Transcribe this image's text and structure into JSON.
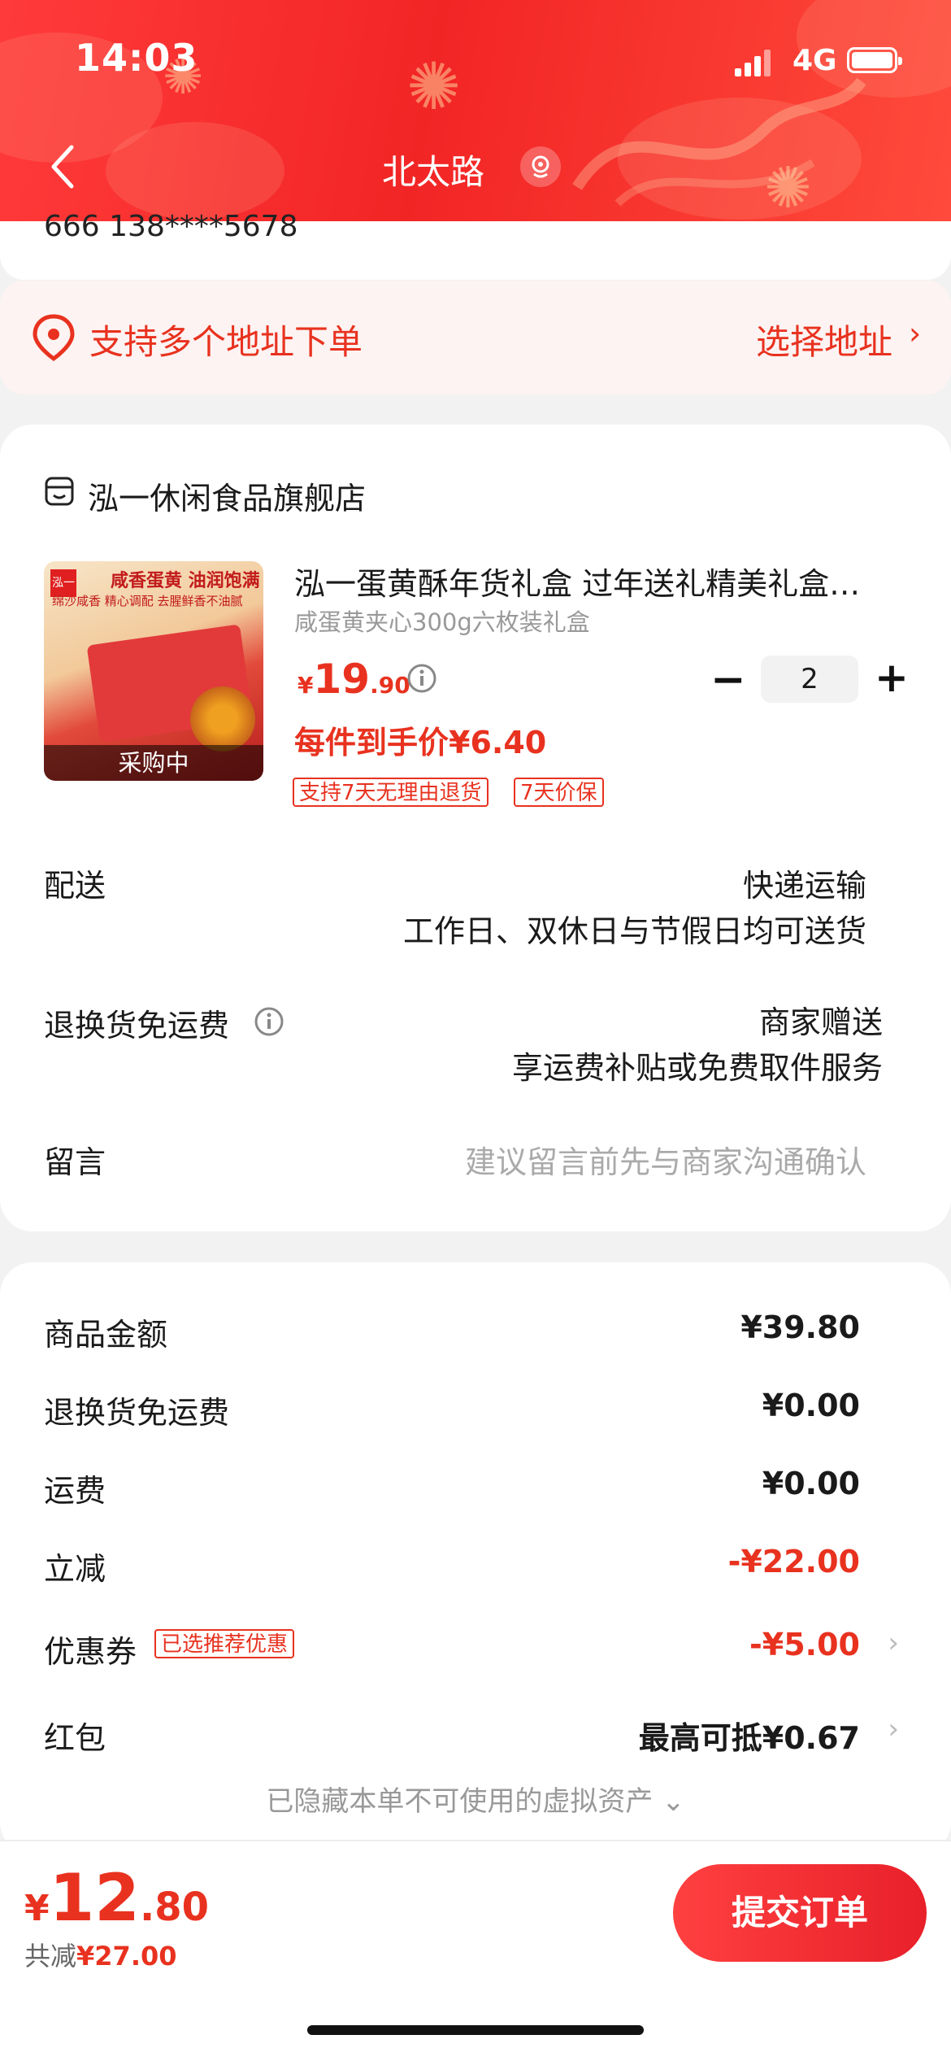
{
  "status_bar": {
    "time": "14:03",
    "network": "4G"
  },
  "header": {
    "title": "北太路"
  },
  "address": {
    "partial": "666  138****5678",
    "multi_label": "支持多个地址下单",
    "choose_label": "选择地址",
    "choose_arrow": "›"
  },
  "store": {
    "name": "泓一休闲食品旗舰店"
  },
  "product": {
    "title": "泓一蛋黄酥年货礼盒 过年送礼精美礼盒…",
    "spec": "咸蛋黄夹心300g六枚装礼盒",
    "price_symbol": "¥",
    "price_int": "19",
    "price_dec": ".90",
    "unit_price": "每件到手价¥6.40",
    "tags": [
      "支持7天无理由退货",
      "7天价保"
    ],
    "thumb_badge": "采购中",
    "thumb_logo": "泓一",
    "thumb_headline": "咸香蛋黄 油润饱满",
    "thumb_subline": "绵沙咸香 精心调配 去腥鲜香不油腻",
    "quantity": "2",
    "minus": "−",
    "plus": "+"
  },
  "shipping": {
    "label": "配送",
    "value1": "快递运输",
    "value2": "工作日、双休日与节假日均可送货"
  },
  "returns": {
    "label": "退换货免运费",
    "value1": "商家赠送",
    "value2": "享运费补贴或免费取件服务"
  },
  "message": {
    "label": "留言",
    "placeholder": "建议留言前先与商家沟通确认"
  },
  "summary": {
    "goods_label": "商品金额",
    "goods_value": "¥39.80",
    "return_label": "退换货免运费",
    "return_value": "¥0.00",
    "freight_label": "运费",
    "freight_value": "¥0.00",
    "discount_label": "立减",
    "discount_value": "-¥22.00",
    "coupon_label": "优惠券",
    "coupon_tag": "已选推荐优惠",
    "coupon_value": "-¥5.00",
    "redpacket_label": "红包",
    "redpacket_value": "最高可抵¥0.67",
    "chevron": "›",
    "hidden_note": "已隐藏本单不可使用的虚拟资产 ⌄"
  },
  "footer": {
    "total_symbol": "¥",
    "total_int": "12",
    "total_dec": ".80",
    "saved_prefix": "共减",
    "saved_value": "¥27.00",
    "submit_label": "提交订单"
  },
  "colors": {
    "accent": "#e8321f",
    "header_red": "#f22525"
  }
}
